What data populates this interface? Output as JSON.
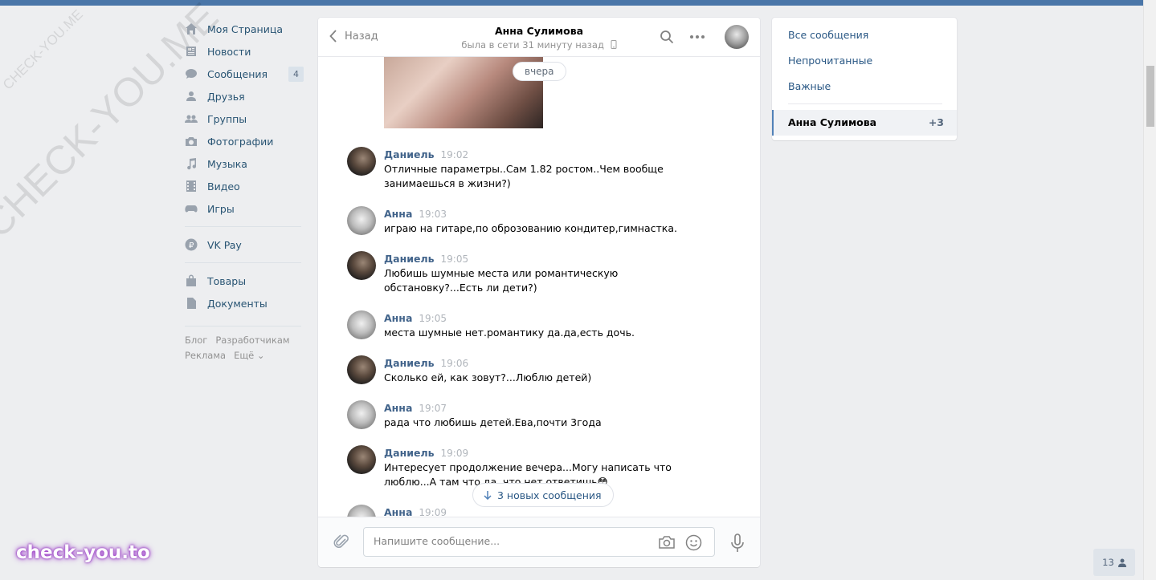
{
  "watermarks": {
    "small": "CHECK-YOU.ME",
    "big": "CHECK-YOU.ME",
    "brand": "check-you.to"
  },
  "nav": {
    "items": [
      {
        "label": "Моя Страница",
        "icon": "home-icon"
      },
      {
        "label": "Новости",
        "icon": "news-icon"
      },
      {
        "label": "Сообщения",
        "icon": "messages-icon",
        "badge": "4"
      },
      {
        "label": "Друзья",
        "icon": "friends-icon"
      },
      {
        "label": "Группы",
        "icon": "groups-icon"
      },
      {
        "label": "Фотографии",
        "icon": "camera-icon"
      },
      {
        "label": "Музыка",
        "icon": "music-icon"
      },
      {
        "label": "Видео",
        "icon": "video-icon"
      },
      {
        "label": "Игры",
        "icon": "games-icon"
      }
    ],
    "vkpay": {
      "label": "VK Pay",
      "icon": "vkpay-icon"
    },
    "extra": [
      {
        "label": "Товары",
        "icon": "bag-icon"
      },
      {
        "label": "Документы",
        "icon": "document-icon"
      }
    ],
    "footer": {
      "blog": "Блог",
      "developers": "Разработчикам",
      "ads": "Реклама",
      "more": "Ещё ⌄"
    }
  },
  "chat": {
    "back_label": "Назад",
    "peer_name": "Анна Сулимова",
    "peer_status": "была в сети 31 минуту назад",
    "date_label": "вчера",
    "messages": [
      {
        "author": "Даниель",
        "time": "19:02",
        "text": "Отличные параметры..Сам 1.82 ростом..Чем вообще занимаешься в жизни?)"
      },
      {
        "author": "Анна",
        "time": "19:03",
        "text": "играю на гитаре,по оброзованию кондитер,гимнастка."
      },
      {
        "author": "Даниель",
        "time": "19:05",
        "text": "Любишь шумные места или романтическую обстановку?...Есть ли дети?)"
      },
      {
        "author": "Анна",
        "time": "19:05",
        "text": "места шумные нет.романтику да.да,есть дочь."
      },
      {
        "author": "Даниель",
        "time": "19:06",
        "text": "Сколько ей, как зовут?...Люблю детей)"
      },
      {
        "author": "Анна",
        "time": "19:07",
        "text": "рада что любишь детей.Ева,почти 3года"
      },
      {
        "author": "Даниель",
        "time": "19:09",
        "text": "Интересует продолжение вечера...Могу написать что люблю...А там что да, что нет ответишь😳"
      },
      {
        "author": "Анна",
        "time": "19:09",
        "text": ""
      }
    ],
    "new_messages_label": "3 новых сообщения",
    "composer_placeholder": "Напишите сообщение..."
  },
  "right": {
    "filters": [
      "Все сообщения",
      "Непрочитанные",
      "Важные"
    ],
    "dialog": {
      "name": "Анна Сулимова",
      "count": "+3"
    }
  },
  "online": {
    "count": "13"
  }
}
